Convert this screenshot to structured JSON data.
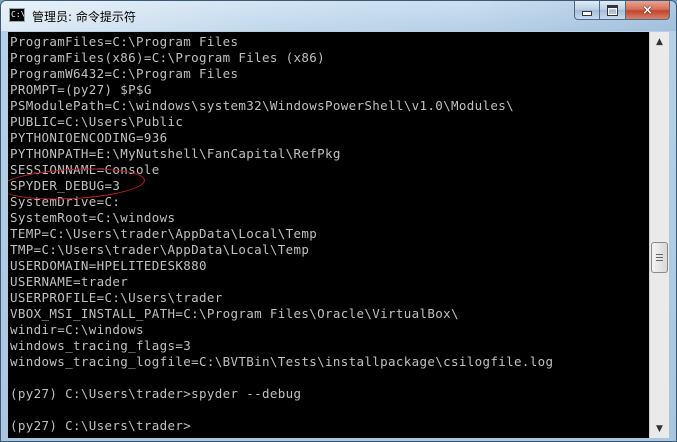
{
  "window": {
    "title": "管理员: 命令提示符",
    "icon_text": "C:\\"
  },
  "caption_buttons": {
    "minimize": "minimize-icon",
    "maximize": "maximize-icon",
    "close": "×"
  },
  "console": {
    "lines": [
      "ProgramFiles=C:\\Program Files",
      "ProgramFiles(x86)=C:\\Program Files (x86)",
      "ProgramW6432=C:\\Program Files",
      "PROMPT=(py27) $P$G",
      "PSModulePath=C:\\windows\\system32\\WindowsPowerShell\\v1.0\\Modules\\",
      "PUBLIC=C:\\Users\\Public",
      "PYTHONIOENCODING=936",
      "PYTHONPATH=E:\\MyNutshell\\FanCapital\\RefPkg",
      "SESSIONNAME=Console",
      "SPYDER_DEBUG=3",
      "SystemDrive=C:",
      "SystemRoot=C:\\windows",
      "TEMP=C:\\Users\\trader\\AppData\\Local\\Temp",
      "TMP=C:\\Users\\trader\\AppData\\Local\\Temp",
      "USERDOMAIN=HPELITEDESK880",
      "USERNAME=trader",
      "USERPROFILE=C:\\Users\\trader",
      "VBOX_MSI_INSTALL_PATH=C:\\Program Files\\Oracle\\VirtualBox\\",
      "windir=C:\\windows",
      "windows_tracing_flags=3",
      "windows_tracing_logfile=C:\\BVTBin\\Tests\\installpackage\\csilogfile.log",
      "",
      "(py27) C:\\Users\\trader>spyder --debug",
      "",
      "(py27) C:\\Users\\trader>"
    ],
    "text_color": "#c0c0c0",
    "background": "#000000",
    "annotation_color": "#c41e1e"
  },
  "scrollbar": {
    "up_arrow": "▲",
    "down_arrow": "▼"
  }
}
